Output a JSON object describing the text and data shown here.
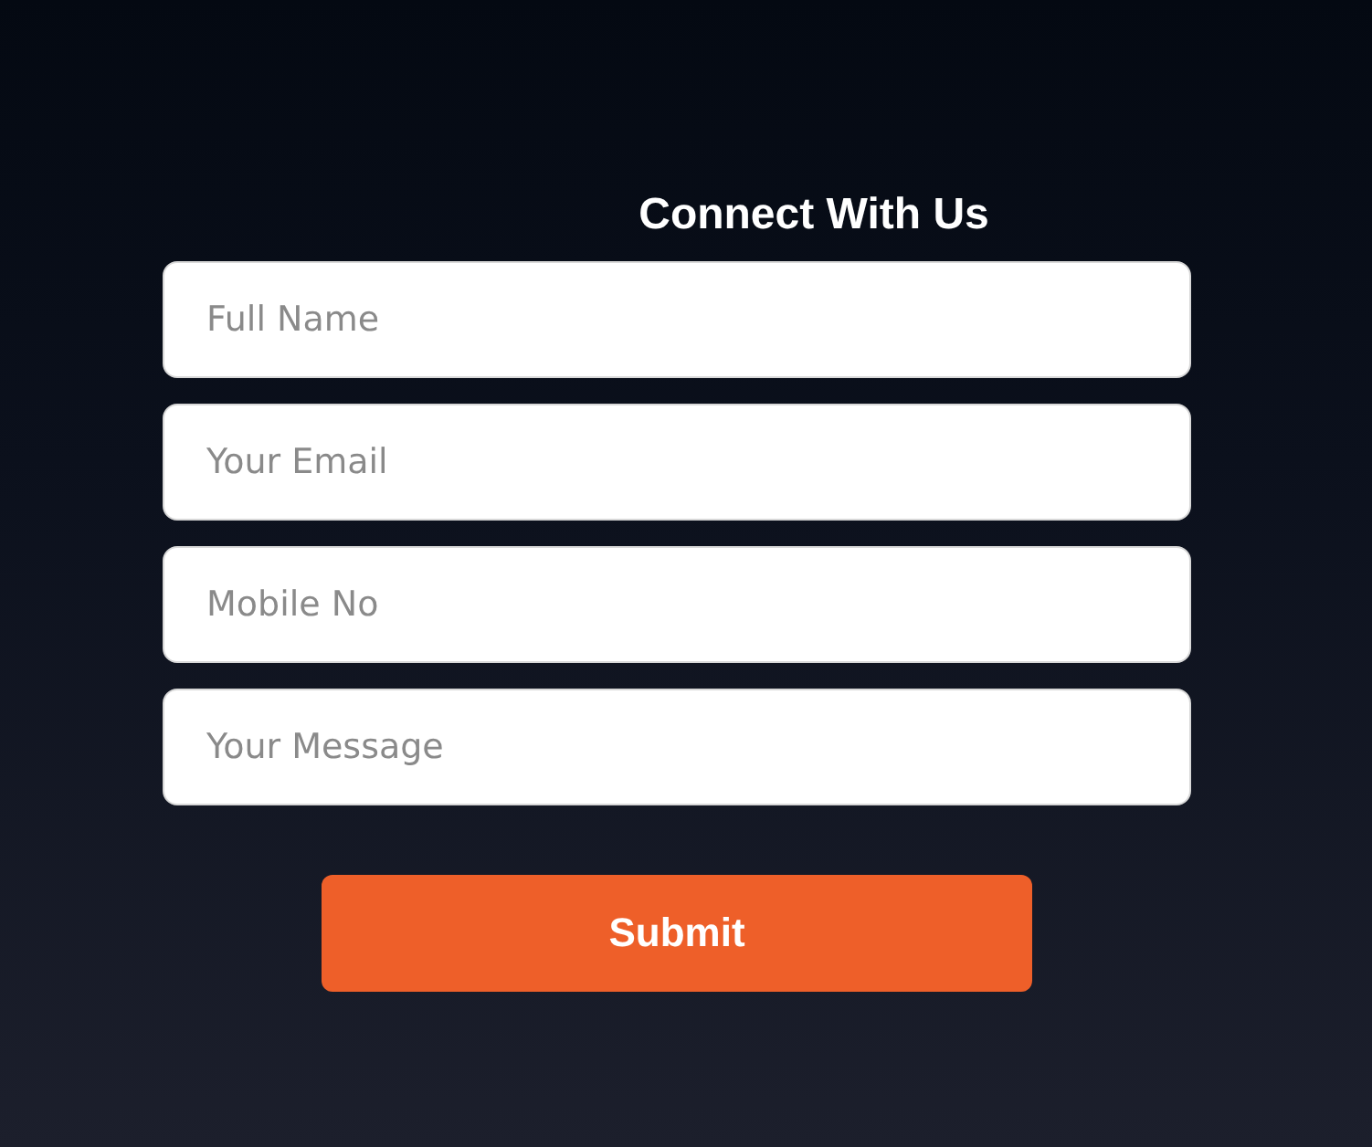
{
  "title": "Connect With Us",
  "fields": [
    {
      "placeholder": "Full Name"
    },
    {
      "placeholder": "Your Email"
    },
    {
      "placeholder": "Mobile No"
    },
    {
      "placeholder": "Your Message"
    }
  ],
  "submit": "Submit"
}
